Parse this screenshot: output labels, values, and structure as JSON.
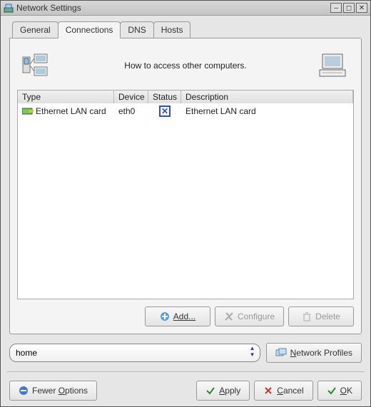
{
  "window": {
    "title": "Network Settings"
  },
  "tabs": [
    {
      "label": "General"
    },
    {
      "label": "Connections"
    },
    {
      "label": "DNS"
    },
    {
      "label": "Hosts"
    }
  ],
  "header": {
    "text": "How to access other computers."
  },
  "table": {
    "columns": {
      "type": "Type",
      "device": "Device",
      "status": "Status",
      "description": "Description"
    },
    "rows": [
      {
        "type": "Ethernet LAN card",
        "device": "eth0",
        "status": "disabled",
        "description": "Ethernet LAN card"
      }
    ]
  },
  "panel_buttons": {
    "add": "Add...",
    "configure": "Configure",
    "delete": "Delete"
  },
  "profile": {
    "selected": "home",
    "network_profiles": "Network Profiles"
  },
  "footer": {
    "fewer_options_pre": "Fewer ",
    "fewer_options_u": "O",
    "fewer_options_post": "ptions",
    "apply_u": "A",
    "apply_post": "pply",
    "cancel_u": "C",
    "cancel_post": "ancel",
    "ok_u": "O",
    "ok_post": "K"
  }
}
